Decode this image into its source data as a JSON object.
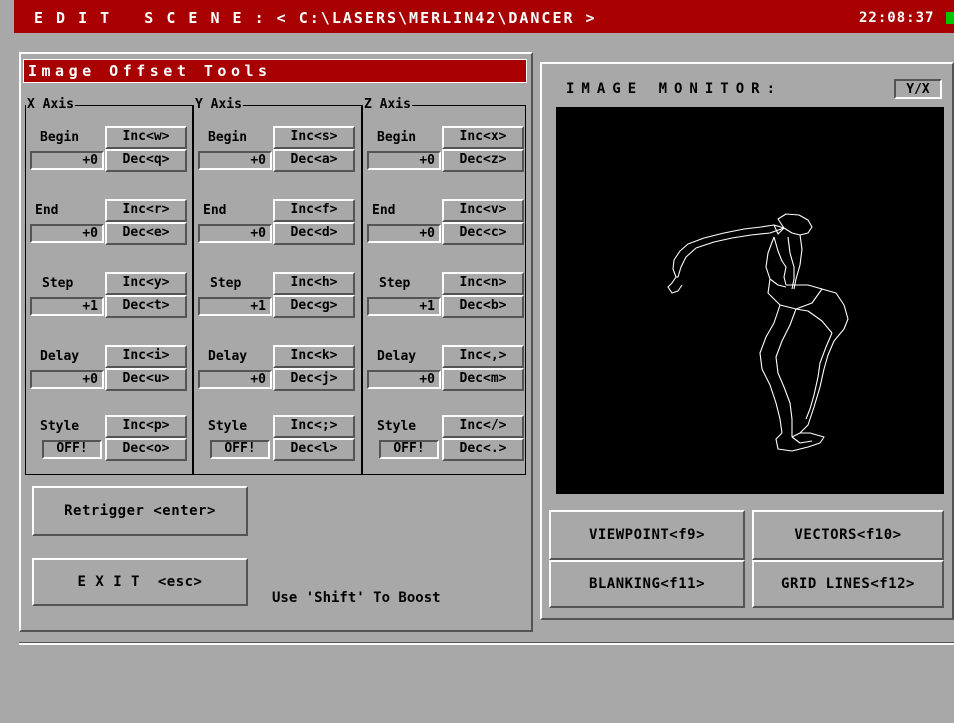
{
  "titlebar": {
    "title": "E D I T   S C E N E : < C:\\LASERS\\MERLIN42\\DANCER >",
    "clock": "22:08:37"
  },
  "tools": {
    "title": "Image Offset Tools",
    "axes": [
      {
        "label": "X Axis",
        "rows": [
          {
            "label": "Begin",
            "value": "+0",
            "inc": "Inc<w>",
            "dec": "Dec<q>"
          },
          {
            "label": "End",
            "value": "+0",
            "inc": "Inc<r>",
            "dec": "Dec<e>"
          },
          {
            "label": "Step",
            "value": "+1",
            "inc": "Inc<y>",
            "dec": "Dec<t>"
          },
          {
            "label": "Delay",
            "value": "+0",
            "inc": "Inc<i>",
            "dec": "Dec<u>"
          },
          {
            "label": "Style",
            "value": "OFF!",
            "inc": "Inc<p>",
            "dec": "Dec<o>"
          }
        ]
      },
      {
        "label": "Y Axis",
        "rows": [
          {
            "label": "Begin",
            "value": "+0",
            "inc": "Inc<s>",
            "dec": "Dec<a>"
          },
          {
            "label": "End",
            "value": "+0",
            "inc": "Inc<f>",
            "dec": "Dec<d>"
          },
          {
            "label": "Step",
            "value": "+1",
            "inc": "Inc<h>",
            "dec": "Dec<g>"
          },
          {
            "label": "Delay",
            "value": "+0",
            "inc": "Inc<k>",
            "dec": "Dec<j>"
          },
          {
            "label": "Style",
            "value": "OFF!",
            "inc": "Inc<;>",
            "dec": "Dec<l>"
          }
        ]
      },
      {
        "label": "Z Axis",
        "rows": [
          {
            "label": "Begin",
            "value": "+0",
            "inc": "Inc<x>",
            "dec": "Dec<z>"
          },
          {
            "label": "End",
            "value": "+0",
            "inc": "Inc<v>",
            "dec": "Dec<c>"
          },
          {
            "label": "Step",
            "value": "+1",
            "inc": "Inc<n>",
            "dec": "Dec<b>"
          },
          {
            "label": "Delay",
            "value": "+0",
            "inc": "Inc<,>",
            "dec": "Dec<m>"
          },
          {
            "label": "Style",
            "value": "OFF!",
            "inc": "Inc</>",
            "dec": "Dec<.>"
          }
        ]
      }
    ],
    "retrigger": "Retrigger <enter>",
    "exit": "E X I T  <esc>",
    "hint": "Use 'Shift' To Boost"
  },
  "monitor": {
    "title": "IMAGE MONITOR:",
    "mode": "Y/X",
    "buttons": {
      "viewpoint": "VIEWPOINT<f9>",
      "vectors": "VECTORS<f10>",
      "blanking": "BLANKING<f11>",
      "grid": "GRID LINES<f12>"
    }
  },
  "colors": {
    "titlebar": "#a80000",
    "panel": "#a8a8a8",
    "screen": "#000000",
    "drawing": "#ffffff",
    "clock_marker": "#00c800"
  }
}
